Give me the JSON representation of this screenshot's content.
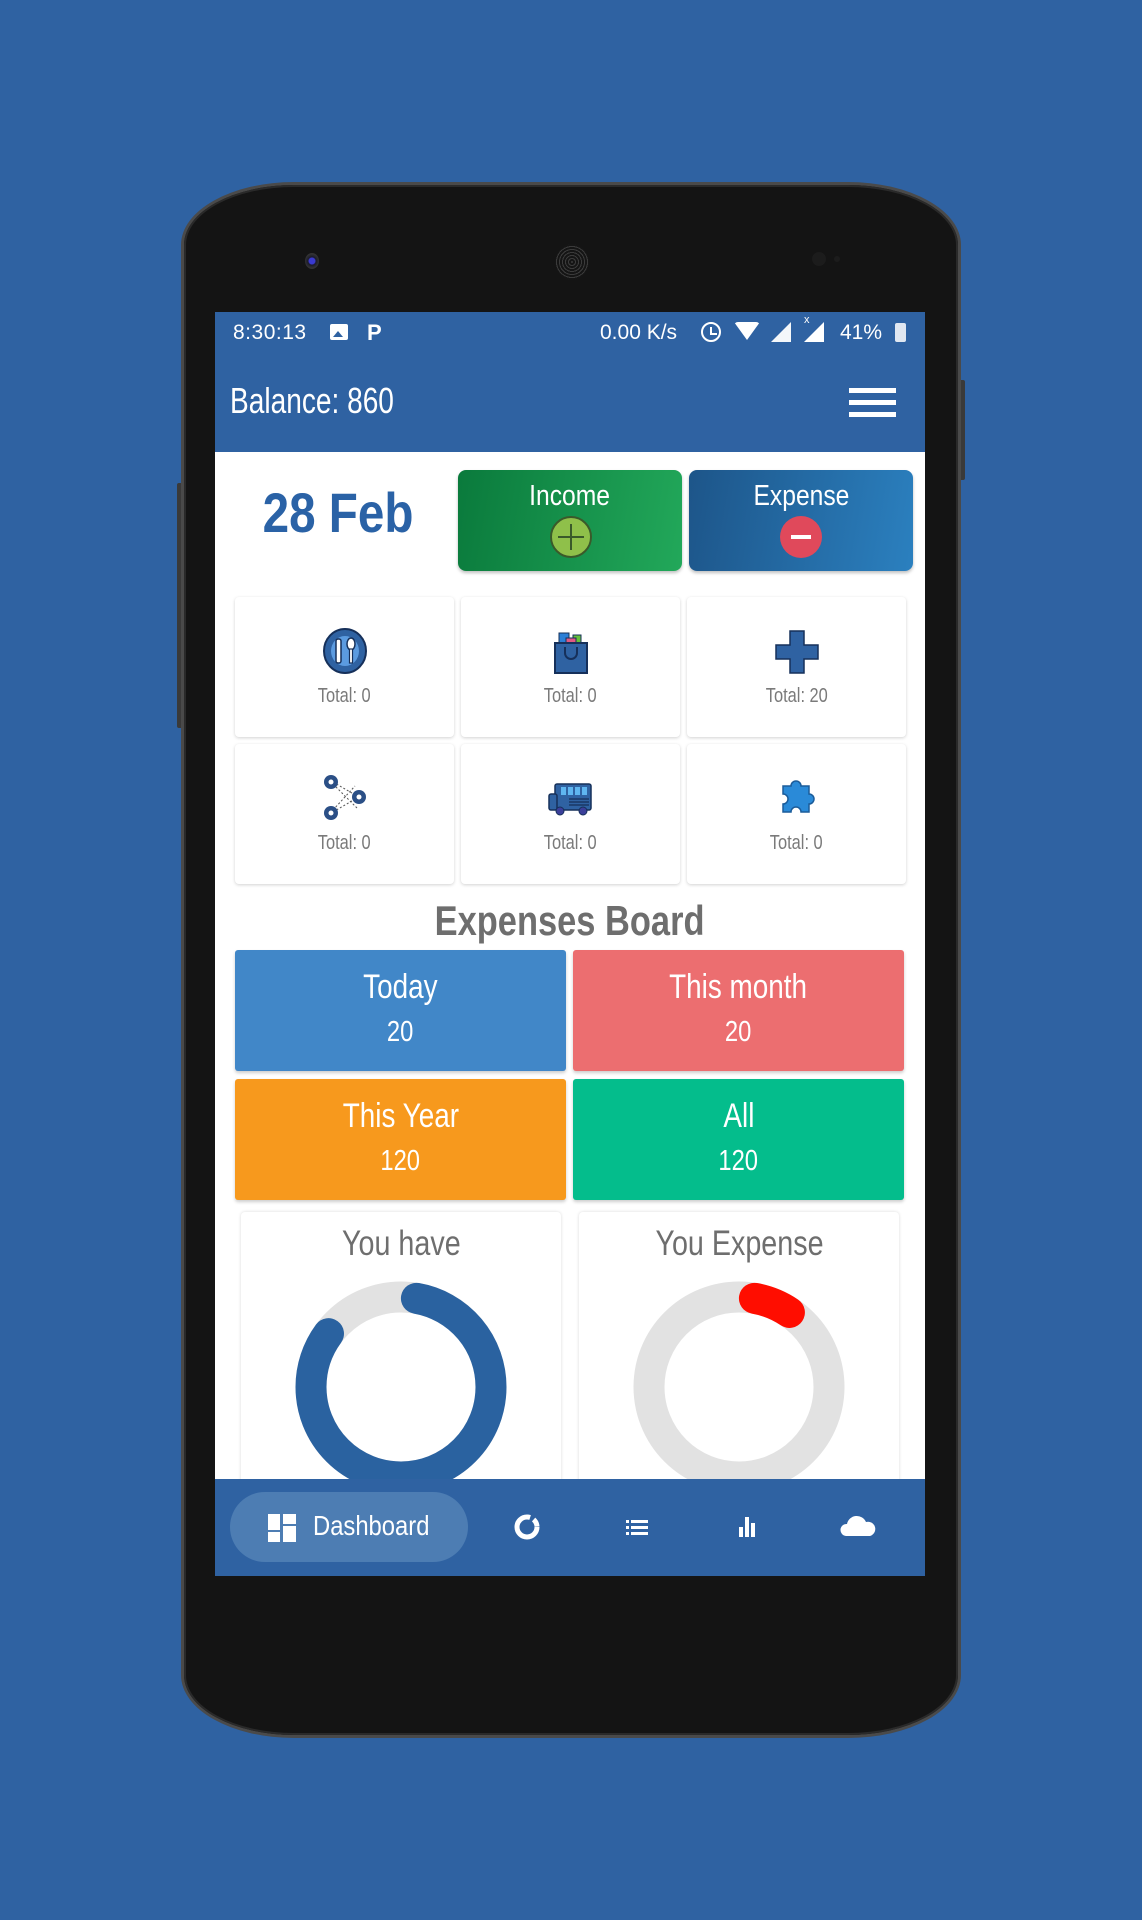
{
  "status_bar": {
    "time": "8:30:13",
    "network_speed": "0.00 K/s",
    "battery": "41%",
    "p_badge": "P"
  },
  "header": {
    "balance_label": "Balance: 860"
  },
  "date": "28 Feb",
  "actions": {
    "income_label": "Income",
    "expense_label": "Expense"
  },
  "categories": [
    {
      "icon": "food-plate-icon",
      "total": "Total: 0"
    },
    {
      "icon": "shopping-bag-icon",
      "total": "Total: 0"
    },
    {
      "icon": "medical-cross-icon",
      "total": "Total: 20"
    },
    {
      "icon": "gears-icon",
      "total": "Total: 0"
    },
    {
      "icon": "bus-icon",
      "total": "Total: 0"
    },
    {
      "icon": "puzzle-icon",
      "total": "Total: 0"
    }
  ],
  "board": {
    "title": "Expenses Board",
    "tiles": [
      {
        "label": "Today",
        "value": "20",
        "color": "#4187c8"
      },
      {
        "label": "This month",
        "value": "20",
        "color": "#ec6e70"
      },
      {
        "label": "This Year",
        "value": "120",
        "color": "#f7991d"
      },
      {
        "label": "All",
        "value": "120",
        "color": "#04bd8c"
      }
    ]
  },
  "summary": {
    "you_have": {
      "title": "You have",
      "fraction": 0.878,
      "color": "#2a62a0",
      "track": "#e2e2e2"
    },
    "you_expense": {
      "title": "You Expense",
      "fraction": 0.122,
      "color": "#ff0d00",
      "track": "#e2e2e2"
    }
  },
  "bottom_nav": {
    "active_label": "Dashboard",
    "items": [
      "dashboard",
      "donut-chart",
      "list",
      "bar-chart",
      "cloud"
    ]
  },
  "colors": {
    "primary": "#2f62a2",
    "date_text": "#2a62a6"
  }
}
